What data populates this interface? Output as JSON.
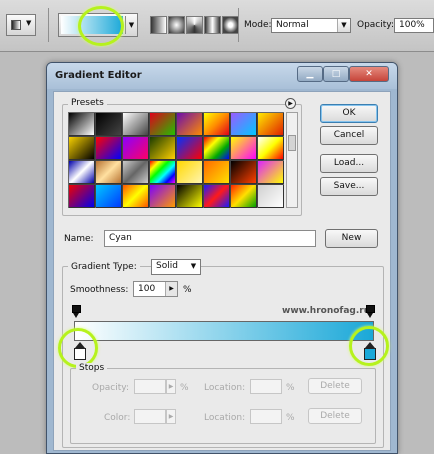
{
  "options_bar": {
    "mode_label": "Mode:",
    "mode_value": "Normal",
    "opacity_label": "Opacity:",
    "opacity_value": "100%"
  },
  "dialog": {
    "title": "Gradient Editor",
    "presets_label": "Presets",
    "buttons": {
      "ok": "OK",
      "cancel": "Cancel",
      "load": "Load...",
      "save": "Save...",
      "new": "New"
    },
    "name_label": "Name:",
    "name_value": "Cyan",
    "gradient_type_label": "Gradient Type:",
    "gradient_type_value": "Solid",
    "smoothness_label": "Smoothness:",
    "smoothness_value": "100",
    "smoothness_unit": "%",
    "watermark": "www.hronofag.ru",
    "stops": {
      "title": "Stops",
      "opacity_label": "Opacity:",
      "opacity_unit": "%",
      "color_label": "Color:",
      "location_label": "Location:",
      "location_unit": "%",
      "delete_label": "Delete"
    }
  },
  "gradient": {
    "start_color": "#ffffff",
    "end_color": "#1aa8d8"
  },
  "colors": {
    "highlight_ring": "#b6f21d",
    "window_frame": "#9fb7d0",
    "close_button": "#c6453a"
  }
}
